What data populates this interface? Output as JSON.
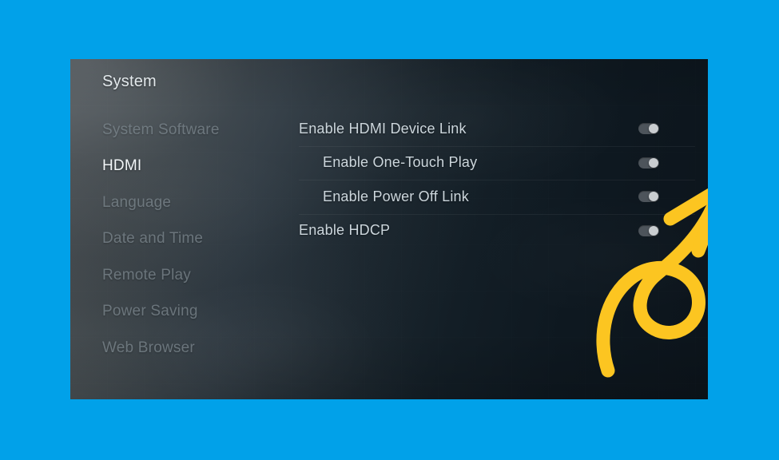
{
  "theme": {
    "frame_color": "#01a1e9",
    "panel_dark": "#0e161d",
    "panel_light": "#4c5053",
    "accent_arrow_color": "#fcc521",
    "selected_text_color": "#f2f6f8",
    "dimmed_text_color": "#7e8990",
    "setting_text_color": "#ccd6dc",
    "toggle_track_color": "#4d545b",
    "toggle_knob_color": "#c9cdd0"
  },
  "header": {
    "title": "System"
  },
  "sidebar": {
    "items": [
      {
        "label": "System Software",
        "selected": false
      },
      {
        "label": "HDMI",
        "selected": true
      },
      {
        "label": "Language",
        "selected": false
      },
      {
        "label": "Date and Time",
        "selected": false
      },
      {
        "label": "Remote Play",
        "selected": false
      },
      {
        "label": "Power Saving",
        "selected": false
      },
      {
        "label": "Web Browser",
        "selected": false
      }
    ]
  },
  "settings": {
    "rows": [
      {
        "label": "Enable HDMI Device Link",
        "indent": false,
        "toggle": "on"
      },
      {
        "label": "Enable One-Touch Play",
        "indent": true,
        "toggle": "on"
      },
      {
        "label": "Enable Power Off Link",
        "indent": true,
        "toggle": "on"
      },
      {
        "label": "Enable HDCP",
        "indent": false,
        "toggle": "on"
      }
    ]
  },
  "annotation": {
    "type": "curly-arrow",
    "color": "#fcc521",
    "points_to": "Enable HDMI Device Link toggle"
  }
}
